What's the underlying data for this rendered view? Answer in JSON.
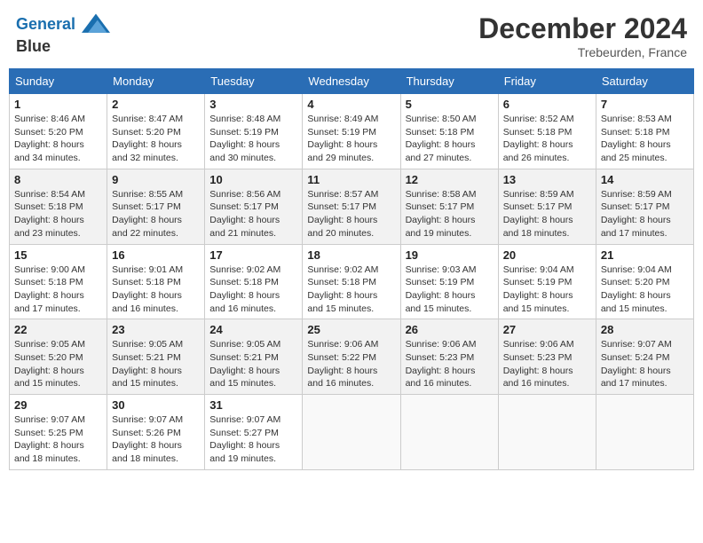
{
  "header": {
    "logo_line1": "General",
    "logo_line2": "Blue",
    "month_year": "December 2024",
    "location": "Trebeurden, France"
  },
  "days_of_week": [
    "Sunday",
    "Monday",
    "Tuesday",
    "Wednesday",
    "Thursday",
    "Friday",
    "Saturday"
  ],
  "weeks": [
    [
      {
        "day": "1",
        "sunrise": "8:46 AM",
        "sunset": "5:20 PM",
        "daylight": "8 hours and 34 minutes."
      },
      {
        "day": "2",
        "sunrise": "8:47 AM",
        "sunset": "5:20 PM",
        "daylight": "8 hours and 32 minutes."
      },
      {
        "day": "3",
        "sunrise": "8:48 AM",
        "sunset": "5:19 PM",
        "daylight": "8 hours and 30 minutes."
      },
      {
        "day": "4",
        "sunrise": "8:49 AM",
        "sunset": "5:19 PM",
        "daylight": "8 hours and 29 minutes."
      },
      {
        "day": "5",
        "sunrise": "8:50 AM",
        "sunset": "5:18 PM",
        "daylight": "8 hours and 27 minutes."
      },
      {
        "day": "6",
        "sunrise": "8:52 AM",
        "sunset": "5:18 PM",
        "daylight": "8 hours and 26 minutes."
      },
      {
        "day": "7",
        "sunrise": "8:53 AM",
        "sunset": "5:18 PM",
        "daylight": "8 hours and 25 minutes."
      }
    ],
    [
      {
        "day": "8",
        "sunrise": "8:54 AM",
        "sunset": "5:18 PM",
        "daylight": "8 hours and 23 minutes."
      },
      {
        "day": "9",
        "sunrise": "8:55 AM",
        "sunset": "5:17 PM",
        "daylight": "8 hours and 22 minutes."
      },
      {
        "day": "10",
        "sunrise": "8:56 AM",
        "sunset": "5:17 PM",
        "daylight": "8 hours and 21 minutes."
      },
      {
        "day": "11",
        "sunrise": "8:57 AM",
        "sunset": "5:17 PM",
        "daylight": "8 hours and 20 minutes."
      },
      {
        "day": "12",
        "sunrise": "8:58 AM",
        "sunset": "5:17 PM",
        "daylight": "8 hours and 19 minutes."
      },
      {
        "day": "13",
        "sunrise": "8:59 AM",
        "sunset": "5:17 PM",
        "daylight": "8 hours and 18 minutes."
      },
      {
        "day": "14",
        "sunrise": "8:59 AM",
        "sunset": "5:17 PM",
        "daylight": "8 hours and 17 minutes."
      }
    ],
    [
      {
        "day": "15",
        "sunrise": "9:00 AM",
        "sunset": "5:18 PM",
        "daylight": "8 hours and 17 minutes."
      },
      {
        "day": "16",
        "sunrise": "9:01 AM",
        "sunset": "5:18 PM",
        "daylight": "8 hours and 16 minutes."
      },
      {
        "day": "17",
        "sunrise": "9:02 AM",
        "sunset": "5:18 PM",
        "daylight": "8 hours and 16 minutes."
      },
      {
        "day": "18",
        "sunrise": "9:02 AM",
        "sunset": "5:18 PM",
        "daylight": "8 hours and 15 minutes."
      },
      {
        "day": "19",
        "sunrise": "9:03 AM",
        "sunset": "5:19 PM",
        "daylight": "8 hours and 15 minutes."
      },
      {
        "day": "20",
        "sunrise": "9:04 AM",
        "sunset": "5:19 PM",
        "daylight": "8 hours and 15 minutes."
      },
      {
        "day": "21",
        "sunrise": "9:04 AM",
        "sunset": "5:20 PM",
        "daylight": "8 hours and 15 minutes."
      }
    ],
    [
      {
        "day": "22",
        "sunrise": "9:05 AM",
        "sunset": "5:20 PM",
        "daylight": "8 hours and 15 minutes."
      },
      {
        "day": "23",
        "sunrise": "9:05 AM",
        "sunset": "5:21 PM",
        "daylight": "8 hours and 15 minutes."
      },
      {
        "day": "24",
        "sunrise": "9:05 AM",
        "sunset": "5:21 PM",
        "daylight": "8 hours and 15 minutes."
      },
      {
        "day": "25",
        "sunrise": "9:06 AM",
        "sunset": "5:22 PM",
        "daylight": "8 hours and 16 minutes."
      },
      {
        "day": "26",
        "sunrise": "9:06 AM",
        "sunset": "5:23 PM",
        "daylight": "8 hours and 16 minutes."
      },
      {
        "day": "27",
        "sunrise": "9:06 AM",
        "sunset": "5:23 PM",
        "daylight": "8 hours and 16 minutes."
      },
      {
        "day": "28",
        "sunrise": "9:07 AM",
        "sunset": "5:24 PM",
        "daylight": "8 hours and 17 minutes."
      }
    ],
    [
      {
        "day": "29",
        "sunrise": "9:07 AM",
        "sunset": "5:25 PM",
        "daylight": "8 hours and 18 minutes."
      },
      {
        "day": "30",
        "sunrise": "9:07 AM",
        "sunset": "5:26 PM",
        "daylight": "8 hours and 18 minutes."
      },
      {
        "day": "31",
        "sunrise": "9:07 AM",
        "sunset": "5:27 PM",
        "daylight": "8 hours and 19 minutes."
      },
      null,
      null,
      null,
      null
    ]
  ]
}
